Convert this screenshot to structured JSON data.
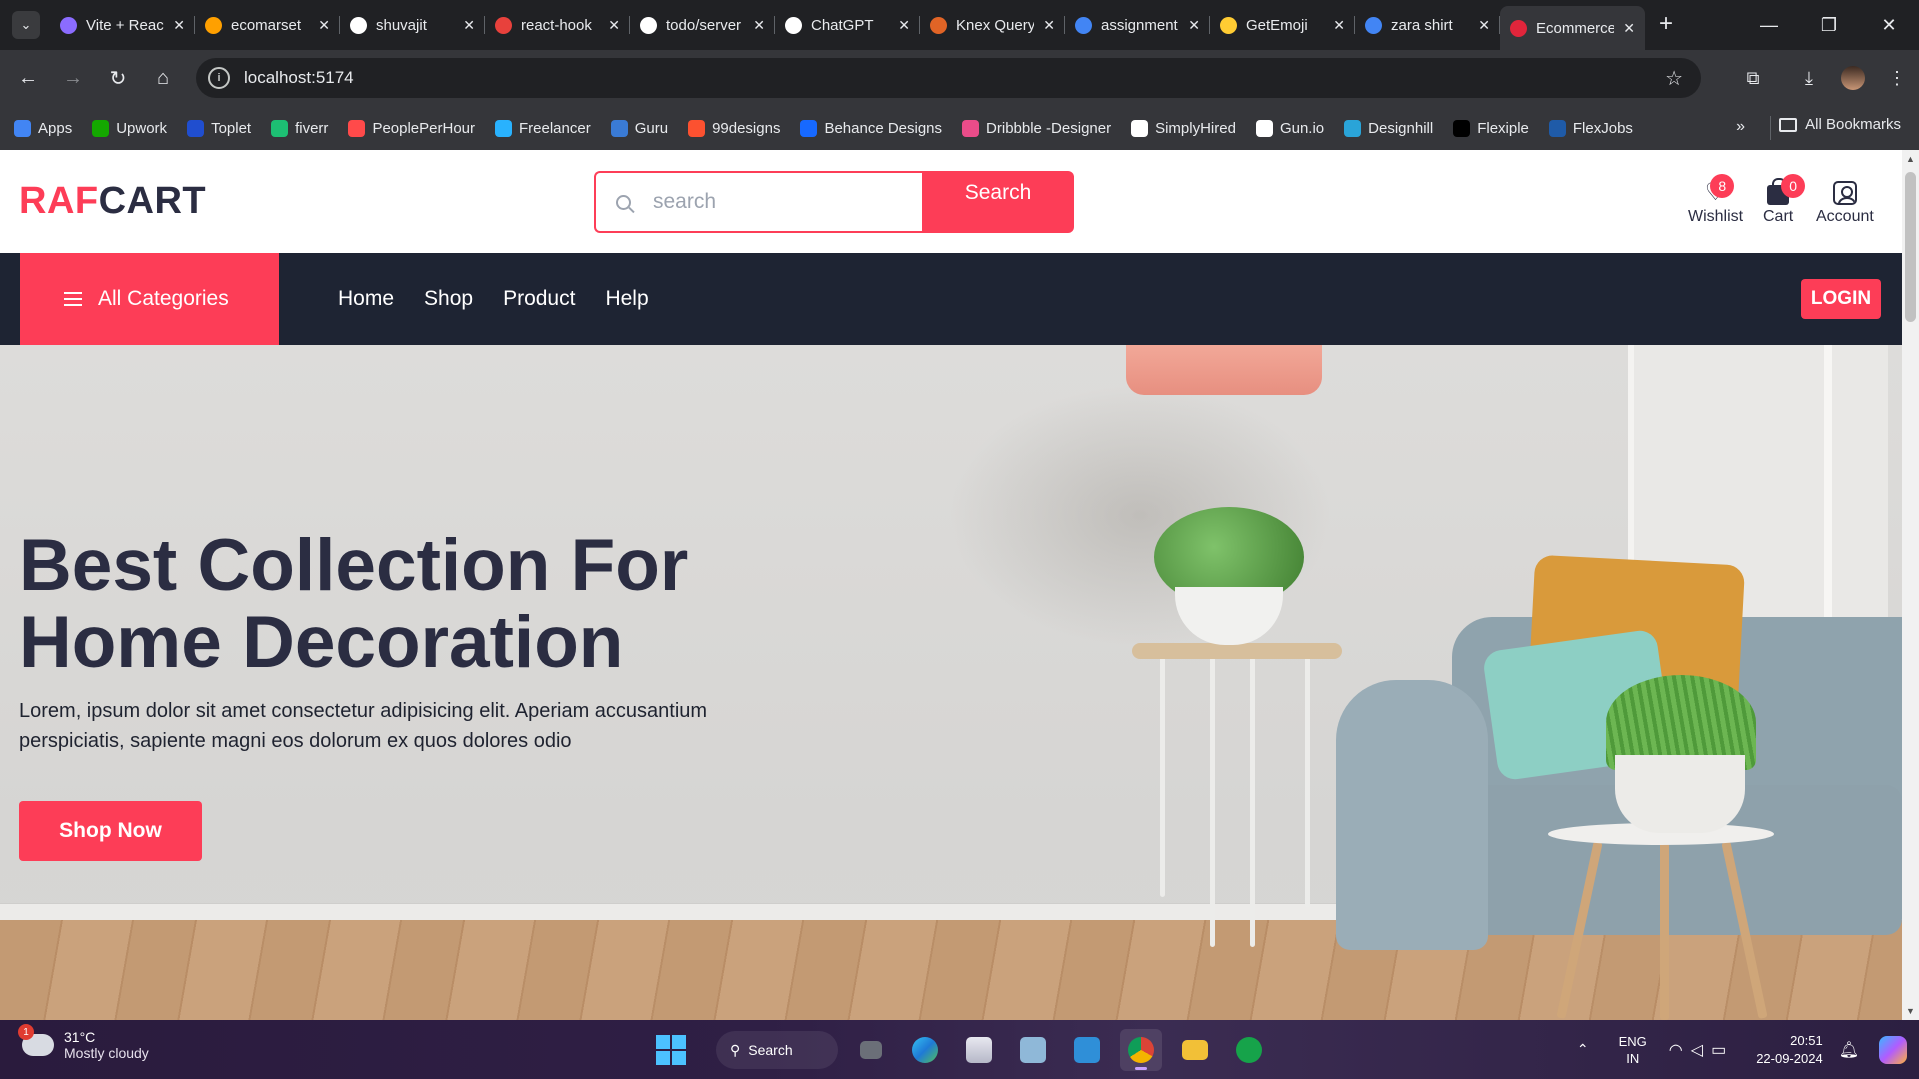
{
  "browser": {
    "tabs": [
      {
        "title": "Vite + React",
        "icon": "vite-icon",
        "color": "#8b6cff"
      },
      {
        "title": "ecomarset",
        "icon": "firebase-icon",
        "color": "#ffa000"
      },
      {
        "title": "shuvajit",
        "icon": "github-icon",
        "color": "#ffffff"
      },
      {
        "title": "react-hook",
        "icon": "h-icon",
        "color": "#e8413c"
      },
      {
        "title": "todo/server",
        "icon": "github-icon",
        "color": "#ffffff"
      },
      {
        "title": "ChatGPT",
        "icon": "openai-icon",
        "color": "#ffffff"
      },
      {
        "title": "Knex Query",
        "icon": "knex-icon",
        "color": "#e16426"
      },
      {
        "title": "assignment",
        "icon": "google-icon",
        "color": "#4285f4"
      },
      {
        "title": "GetEmoji",
        "icon": "emoji-icon",
        "color": "#ffcc33"
      },
      {
        "title": "zara shirt",
        "icon": "google-icon",
        "color": "#4285f4"
      },
      {
        "title": "Ecommerce",
        "icon": "fs-icon",
        "color": "#e1253b"
      }
    ],
    "address": "localhost:5174",
    "bookmarks": [
      {
        "label": "Apps",
        "icon": "apps-grid-icon",
        "color": "#4285f4"
      },
      {
        "label": "Upwork",
        "icon": "upwork-icon",
        "color": "#14a800"
      },
      {
        "label": "Toplet",
        "icon": "toptal-icon",
        "color": "#204ecf"
      },
      {
        "label": "fiverr",
        "icon": "fiverr-icon",
        "color": "#1dbf73"
      },
      {
        "label": "PeoplePerHour",
        "icon": "pph-icon",
        "color": "#ff4a4a"
      },
      {
        "label": "Freelancer",
        "icon": "freelancer-icon",
        "color": "#29b2fe"
      },
      {
        "label": "Guru",
        "icon": "guru-icon",
        "color": "#3a7bd5"
      },
      {
        "label": "99designs",
        "icon": "99designs-icon",
        "color": "#fc5130"
      },
      {
        "label": "Behance Designs",
        "icon": "behance-icon",
        "color": "#1769ff"
      },
      {
        "label": "Dribbble -Designer",
        "icon": "dribbble-icon",
        "color": "#ea4c89"
      },
      {
        "label": "SimplyHired",
        "icon": "simplyhired-icon",
        "color": "#ffffff"
      },
      {
        "label": "Gun.io",
        "icon": "gunio-icon",
        "color": "#ffffff"
      },
      {
        "label": "Designhill",
        "icon": "designhill-icon",
        "color": "#2aa4d8"
      },
      {
        "label": "Flexiple",
        "icon": "flexiple-icon",
        "color": "#000000"
      },
      {
        "label": "FlexJobs",
        "icon": "flexjobs-icon",
        "color": "#1f5ba8"
      }
    ],
    "all_bookmarks": "All Bookmarks"
  },
  "site": {
    "logo_part1": "RAF",
    "logo_part2": "CART",
    "search_placeholder": "search",
    "search_button": "Search",
    "wishlist_label": "Wishlist",
    "wishlist_count": "8",
    "cart_label": "Cart",
    "cart_count": "0",
    "account_label": "Account",
    "all_categories": "All Categories",
    "menu": [
      "Home",
      "Shop",
      "Product",
      "Help"
    ],
    "login": "LOGIN",
    "hero_title_line1": "Best Collection For",
    "hero_title_line2": "Home Decoration",
    "hero_text": "Lorem, ipsum dolor sit amet consectetur adipisicing elit. Aperiam accusantium perspiciatis, sapiente magni eos dolorum ex quos dolores odio",
    "shop_now": "Shop Now",
    "colors": {
      "accent": "#fd3d57",
      "dark": "#2b2d42",
      "nav": "#1e2433"
    }
  },
  "taskbar": {
    "notification_count": "1",
    "temperature": "31°C",
    "weather": "Mostly cloudy",
    "search": "Search",
    "lang1": "ENG",
    "lang2": "IN",
    "time": "20:51",
    "date": "22-09-2024"
  }
}
